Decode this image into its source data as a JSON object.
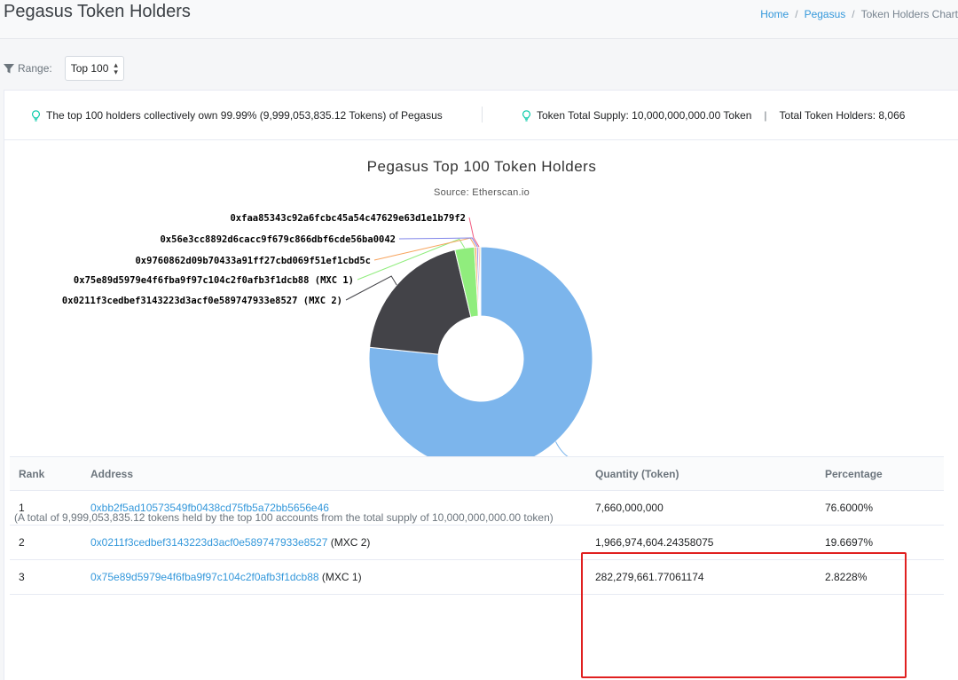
{
  "header": {
    "title": "Pegasus Token Holders",
    "breadcrumb": [
      "Home",
      "Pegasus",
      "Token Holders Chart"
    ]
  },
  "range": {
    "label": "Range:",
    "selected": "Top 100"
  },
  "summary": {
    "left": "The top 100 holders collectively own 99.99% (9,999,053,835.12 Tokens) of Pegasus",
    "supply": "Token Total Supply: 10,000,000,000.00 Token",
    "holders": "Total Token Holders: 8,066"
  },
  "chart_data": {
    "type": "pie",
    "title": "Pegasus Top 100 Token Holders",
    "subtitle": "Source: Etherscan.io",
    "slices": [
      {
        "label": "0xbb2f5ad10573549fb0438cd75fb5a72bb5656e46",
        "value": 76.6,
        "color": "#7cb5ec"
      },
      {
        "label": "0x0211f3cedbef3143223d3acf0e589747933e8527 (MXC 2)",
        "value": 19.6697,
        "color": "#434348"
      },
      {
        "label": "0x75e89d5979e4f6fba9f97c104c2f0afb3f1dcb88 (MXC 1)",
        "value": 2.8228,
        "color": "#90ed7d"
      },
      {
        "label": "0x9760862d09b70433a91ff27cbd069f51ef1cbd5c",
        "value": 0.3,
        "color": "#f7a35c"
      },
      {
        "label": "0x56e3cc8892d6cacc9f679c866dbf6cde56ba0042",
        "value": 0.25,
        "color": "#8085e9"
      },
      {
        "label": "0xfaa85343c92a6fcbc45a54c47629e63d1e1b79f2",
        "value": 0.2,
        "color": "#f15c80"
      },
      {
        "label": "",
        "value": 0.15,
        "color": "#e4d354"
      }
    ]
  },
  "note": "(A total of 9,999,053,835.12 tokens held by the top 100 accounts from the total supply of 10,000,000,000.00 token)",
  "table": {
    "headers": [
      "Rank",
      "Address",
      "Quantity (Token)",
      "Percentage"
    ],
    "rows": [
      {
        "rank": "1",
        "address": "0xbb2f5ad10573549fb0438cd75fb5a72bb5656e46",
        "tag": "",
        "quantity": "7,660,000,000",
        "percentage": "76.6000%"
      },
      {
        "rank": "2",
        "address": "0x0211f3cedbef3143223d3acf0e589747933e8527",
        "tag": "(MXC 2)",
        "quantity": "1,966,974,604.24358075",
        "percentage": "19.6697%"
      },
      {
        "rank": "3",
        "address": "0x75e89d5979e4f6fba9f97c104c2f0afb3f1dcb88",
        "tag": "(MXC 1)",
        "quantity": "282,279,661.77061174",
        "percentage": "2.8228%"
      }
    ]
  }
}
